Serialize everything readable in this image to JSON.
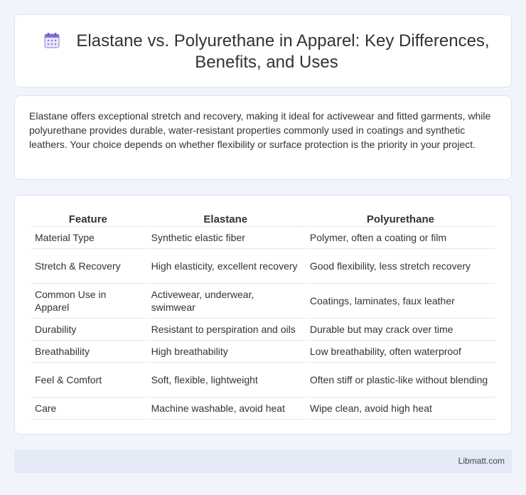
{
  "header": {
    "icon": "calendar-icon",
    "title": "Elastane vs. Polyurethane in Apparel: Key Differences, Benefits, and Uses"
  },
  "intro": {
    "text": "Elastane offers exceptional stretch and recovery, making it ideal for activewear and fitted garments, while polyurethane provides durable, water-resistant properties commonly used in coatings and synthetic leathers. Your choice depends on whether flexibility or surface protection is the priority in your project."
  },
  "table": {
    "headers": [
      "Feature",
      "Elastane",
      "Polyurethane"
    ],
    "rows": [
      [
        "Material Type",
        "Synthetic elastic fiber",
        "Polymer, often a coating or film"
      ],
      [
        "Stretch & Recovery",
        "High elasticity, excellent recovery",
        "Good flexibility, less stretch recovery"
      ],
      [
        "Common Use in Apparel",
        "Activewear, underwear, swimwear",
        "Coatings, laminates, faux leather"
      ],
      [
        "Durability",
        "Resistant to perspiration and oils",
        "Durable but may crack over time"
      ],
      [
        "Breathability",
        "High breathability",
        "Low breathability, often waterproof"
      ],
      [
        "Feel & Comfort",
        "Soft, flexible, lightweight",
        "Often stiff or plastic-like without blending"
      ],
      [
        "Care",
        "Machine washable, avoid heat",
        "Wipe clean, avoid high heat"
      ]
    ]
  },
  "footer": {
    "text": "Libmatt.com"
  }
}
